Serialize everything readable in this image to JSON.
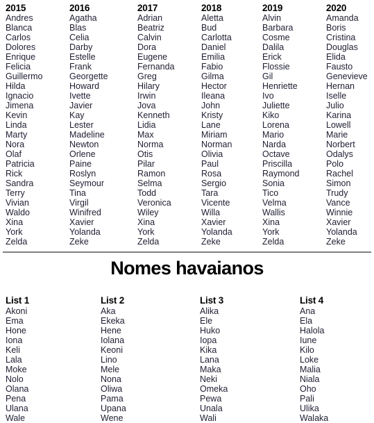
{
  "years_section": {
    "columns": [
      {
        "header": "2015",
        "names": [
          "Andres",
          "Blanca",
          "Carlos",
          "Dolores",
          "Enrique",
          "Felicia",
          "Guillermo",
          "Hilda",
          "Ignacio",
          "Jimena",
          "Kevin",
          "Linda",
          "Marty",
          "Nora",
          "Olaf",
          "Patricia",
          "Rick",
          "Sandra",
          "Terry",
          "Vivian",
          "Waldo",
          "Xina",
          "York",
          "Zelda"
        ]
      },
      {
        "header": "2016",
        "names": [
          "Agatha",
          "Blas",
          "Celia",
          "Darby",
          "Estelle",
          "Frank",
          "Georgette",
          "Howard",
          "Ivette",
          "Javier",
          "Kay",
          "Lester",
          "Madeline",
          "Newton",
          "Orlene",
          "Paine",
          "Roslyn",
          "Seymour",
          "Tina",
          "Virgil",
          "Winifred",
          "Xavier",
          "Yolanda",
          "Zeke"
        ]
      },
      {
        "header": "2017",
        "names": [
          "Adrian",
          "Beatriz",
          "Calvin",
          "Dora",
          "Eugene",
          "Fernanda",
          "Greg",
          "Hilary",
          "Irwin",
          "Jova",
          "Kenneth",
          "Lidia",
          "Max",
          "Norma",
          "Otis",
          "Pilar",
          "Ramon",
          "Selma",
          "Todd",
          "Veronica",
          "Wiley",
          "Xina",
          "York",
          "Zelda"
        ]
      },
      {
        "header": "2018",
        "names": [
          "Aletta",
          "Bud",
          "Carlotta",
          "Daniel",
          "Emilia",
          "Fabio",
          "Gilma",
          "Hector",
          "Ileana",
          "John",
          "Kristy",
          "Lane",
          "Miriam",
          "Norman",
          "Olivia",
          "Paul",
          "Rosa",
          "Sergio",
          "Tara",
          "Vicente",
          "Willa",
          "Xavier",
          "Yolanda",
          "Zeke"
        ]
      },
      {
        "header": "2019",
        "names": [
          "Alvin",
          "Barbara",
          "Cosme",
          "Dalila",
          "Erick",
          "Flossie",
          "Gil",
          "Henriette",
          "Ivo",
          "Juliette",
          "Kiko",
          "Lorena",
          "Mario",
          "Narda",
          "Octave",
          "Priscilla",
          "Raymond",
          "Sonia",
          "Tico",
          "Velma",
          "Wallis",
          "Xina",
          "York",
          "Zelda"
        ]
      },
      {
        "header": "2020",
        "names": [
          "Amanda",
          "Boris",
          "Cristina",
          "Douglas",
          "Elida",
          "Fausto",
          "Genevieve",
          "Hernan",
          "Iselle",
          "Julio",
          "Karina",
          "Lowell",
          "Marie",
          "Norbert",
          "Odalys",
          "Polo",
          "Rachel",
          "Simon",
          "Trudy",
          "Vance",
          "Winnie",
          "Xavier",
          "Yolanda",
          "Zeke"
        ]
      }
    ]
  },
  "hawaiian_section": {
    "title": "Nomes havaianos",
    "columns": [
      {
        "header": "List 1",
        "names": [
          "Akoni",
          "Ema",
          "Hone",
          "Iona",
          "Keli",
          "Lala",
          "Moke",
          "Nolo",
          "Olana",
          "Pena",
          "Ulana",
          "Wale"
        ]
      },
      {
        "header": "List 2",
        "names": [
          "Aka",
          "Ekeka",
          "Hene",
          "Iolana",
          "Keoni",
          "Lino",
          "Mele",
          "Nona",
          "Oliwa",
          "Pama",
          "Upana",
          "Wene"
        ]
      },
      {
        "header": "List 3",
        "names": [
          "Alika",
          "Ele",
          "Huko",
          "Iopa",
          "Kika",
          "Lana",
          "Maka",
          "Neki",
          "Omeka",
          "Pewa",
          "Unala",
          "Wali"
        ]
      },
      {
        "header": "List 4",
        "names": [
          "Ana",
          "Ela",
          "Halola",
          "Iune",
          "Kilo",
          "Loke",
          "Malia",
          "Niala",
          "Oho",
          "Pali",
          "Ulika",
          "Walaka"
        ]
      }
    ]
  },
  "colors": {
    "name_text": "#1e1e32",
    "header_text": "#000000",
    "divider": "#808080",
    "background": "#ffffff"
  }
}
